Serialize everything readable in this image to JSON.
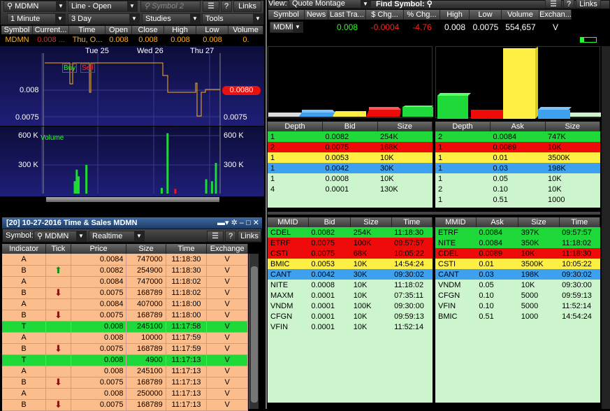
{
  "left_top": {
    "symbol": "MDMN",
    "chart_type": "Line - Open",
    "symbol2": "Symbol 2",
    "links": "Links",
    "interval": "1 Minute",
    "range": "3 Day",
    "studies": "Studies",
    "tools": "Tools",
    "quote_headers": [
      "Symbol",
      "Current...",
      "Time",
      "Open",
      "Close",
      "High",
      "Low",
      "Volume"
    ],
    "quote_values": [
      "MDMN",
      "0.008 ...",
      "Thu, O...",
      "0.008",
      "0.008",
      "0.008",
      "0.008",
      "0."
    ],
    "days": [
      "Tue 25",
      "Wed 26",
      "Thu 27"
    ],
    "price_axis": [
      "0.008",
      "0.0075"
    ],
    "price_axis_right": [
      "0.008",
      "0.0075"
    ],
    "current_price_tag": "0.0080",
    "buy_label": "Buy",
    "sell_label": "Sell",
    "volume_label": "Volume",
    "vol_axis": [
      "600 K",
      "300 K"
    ],
    "vol_axis_right": [
      "600 K",
      "300 K"
    ]
  },
  "chart_data": {
    "type": "bar",
    "title": "",
    "ylabel": "Volume",
    "ylim": [
      0,
      700000
    ],
    "values": [
      0,
      0,
      0,
      0,
      0,
      0,
      0,
      0,
      0,
      0,
      0,
      0,
      0,
      0,
      0,
      130000,
      250000,
      180000,
      0,
      0,
      0,
      300000,
      0,
      0,
      0,
      0,
      0,
      0,
      0,
      0,
      0,
      0,
      0,
      0,
      0,
      0,
      0,
      0,
      0,
      0,
      0,
      0,
      0,
      0,
      0,
      0,
      0,
      0,
      0,
      0,
      0,
      0,
      0,
      0,
      0,
      0,
      0,
      0,
      0,
      0,
      60000,
      0,
      0,
      630000,
      0,
      0,
      0,
      50000,
      0,
      0,
      0,
      0,
      0,
      0,
      0,
      0,
      0,
      0,
      0,
      0,
      0,
      0,
      0,
      150000,
      0,
      0,
      130000,
      0,
      320000,
      0
    ]
  },
  "ts": {
    "title": "[20] 10-27-2016 Time & Sales MDMN",
    "symbol_label": "Symbol:",
    "symbol": "MDMN",
    "mode": "Realtime",
    "links": "Links",
    "headers": [
      "Indicator",
      "Tick",
      "Price",
      "Size",
      "Time",
      "Exchange"
    ],
    "rows": [
      {
        "ind": "A",
        "tick": "",
        "price": "0.0084",
        "size": "747000",
        "time": "11:18:30",
        "ex": "V",
        "c": "o"
      },
      {
        "ind": "B",
        "tick": "up",
        "price": "0.0082",
        "size": "254900",
        "time": "11:18:30",
        "ex": "V",
        "c": "o"
      },
      {
        "ind": "A",
        "tick": "",
        "price": "0.0084",
        "size": "747000",
        "time": "11:18:02",
        "ex": "V",
        "c": "o"
      },
      {
        "ind": "B",
        "tick": "down",
        "price": "0.0075",
        "size": "168789",
        "time": "11:18:02",
        "ex": "V",
        "c": "o"
      },
      {
        "ind": "A",
        "tick": "",
        "price": "0.0084",
        "size": "407000",
        "time": "11:18:00",
        "ex": "V",
        "c": "o"
      },
      {
        "ind": "B",
        "tick": "down",
        "price": "0.0075",
        "size": "168789",
        "time": "11:18:00",
        "ex": "V",
        "c": "o"
      },
      {
        "ind": "T",
        "tick": "",
        "price": "0.008",
        "size": "245100",
        "time": "11:17:58",
        "ex": "V",
        "c": "g"
      },
      {
        "ind": "A",
        "tick": "",
        "price": "0.008",
        "size": "10000",
        "time": "11:17:59",
        "ex": "V",
        "c": "o"
      },
      {
        "ind": "B",
        "tick": "down",
        "price": "0.0075",
        "size": "168789",
        "time": "11:17:59",
        "ex": "V",
        "c": "o"
      },
      {
        "ind": "T",
        "tick": "",
        "price": "0.008",
        "size": "4900",
        "time": "11:17:13",
        "ex": "V",
        "c": "g"
      },
      {
        "ind": "A",
        "tick": "",
        "price": "0.008",
        "size": "245100",
        "time": "11:17:13",
        "ex": "V",
        "c": "o"
      },
      {
        "ind": "B",
        "tick": "down",
        "price": "0.0075",
        "size": "168789",
        "time": "11:17:13",
        "ex": "V",
        "c": "o"
      },
      {
        "ind": "A",
        "tick": "",
        "price": "0.008",
        "size": "250000",
        "time": "11:17:13",
        "ex": "V",
        "c": "o"
      },
      {
        "ind": "B",
        "tick": "down",
        "price": "0.0075",
        "size": "168789",
        "time": "11:17:13",
        "ex": "V",
        "c": "o"
      }
    ]
  },
  "right": {
    "view_label": "View:",
    "view": "Quote Montage",
    "find_label": "Find Symbol:",
    "links": "Links",
    "q_headers": [
      "Symbol",
      "News",
      "Last Tra...",
      "$ Chg...",
      "% Chg...",
      "High",
      "Low",
      "Volume",
      "Exchan..."
    ],
    "q_values": [
      "MDMN",
      "",
      "0.008",
      "-0.0004",
      "-4.76",
      "0.008",
      "0.0075",
      "554,657",
      "V"
    ],
    "bid_depth_headers": [
      "Depth",
      "Bid",
      "Size"
    ],
    "bid_depth": [
      [
        "1",
        "0.0082",
        "254K",
        "g"
      ],
      [
        "2",
        "0.0075",
        "168K",
        "r"
      ],
      [
        "1",
        "0.0053",
        "10K",
        "y"
      ],
      [
        "1",
        "0.0042",
        "30K",
        "b"
      ],
      [
        "1",
        "0.0008",
        "10K",
        "l"
      ],
      [
        "4",
        "0.0001",
        "130K",
        "l"
      ]
    ],
    "ask_depth_headers": [
      "Depth",
      "Ask",
      "Size"
    ],
    "ask_depth": [
      [
        "2",
        "0.0084",
        "747K",
        "g"
      ],
      [
        "1",
        "0.0089",
        "10K",
        "r"
      ],
      [
        "1",
        "0.01",
        "3500K",
        "y"
      ],
      [
        "1",
        "0.03",
        "198K",
        "b"
      ],
      [
        "1",
        "0.05",
        "10K",
        "l"
      ],
      [
        "2",
        "0.10",
        "10K",
        "l"
      ],
      [
        "1",
        "0.51",
        "1000",
        "l"
      ]
    ],
    "bid_mm_headers": [
      "MMID",
      "Bid",
      "Size",
      "Time"
    ],
    "bid_mm": [
      [
        "CDEL",
        "0.0082",
        "254K",
        "11:18:30",
        "g"
      ],
      [
        "ETRF",
        "0.0075",
        "100K",
        "09:57:57",
        "r"
      ],
      [
        "CSTI",
        "0.0075",
        "68K",
        "10:05:22",
        "r"
      ],
      [
        "BMIC",
        "0.0053",
        "10K",
        "14:54:24",
        "y"
      ],
      [
        "CANT",
        "0.0042",
        "30K",
        "09:30:02",
        "b"
      ],
      [
        "NITE",
        "0.0008",
        "10K",
        "11:18:02",
        "l"
      ],
      [
        "MAXM",
        "0.0001",
        "10K",
        "07:35:11",
        "l"
      ],
      [
        "VNDM",
        "0.0001",
        "100K",
        "09:30:00",
        "l"
      ],
      [
        "CFGN",
        "0.0001",
        "10K",
        "09:59:13",
        "l"
      ],
      [
        "VFIN",
        "0.0001",
        "10K",
        "11:52:14",
        "l"
      ]
    ],
    "ask_mm_headers": [
      "MMID",
      "Ask",
      "Size",
      "Time"
    ],
    "ask_mm": [
      [
        "ETRF",
        "0.0084",
        "397K",
        "09:57:57",
        "g"
      ],
      [
        "NITE",
        "0.0084",
        "350K",
        "11:18:02",
        "g"
      ],
      [
        "CDEL",
        "0.0089",
        "10K",
        "11:18:30",
        "r"
      ],
      [
        "CSTI",
        "0.01",
        "3500K",
        "10:05:22",
        "y"
      ],
      [
        "CANT",
        "0.03",
        "198K",
        "09:30:02",
        "b"
      ],
      [
        "VNDM",
        "0.05",
        "10K",
        "09:30:00",
        "l"
      ],
      [
        "CFGN",
        "0.10",
        "5000",
        "09:59:13",
        "l"
      ],
      [
        "VFIN",
        "0.10",
        "5000",
        "11:52:14",
        "l"
      ],
      [
        "BMIC",
        "0.51",
        "1000",
        "14:54:24",
        "l"
      ]
    ]
  }
}
